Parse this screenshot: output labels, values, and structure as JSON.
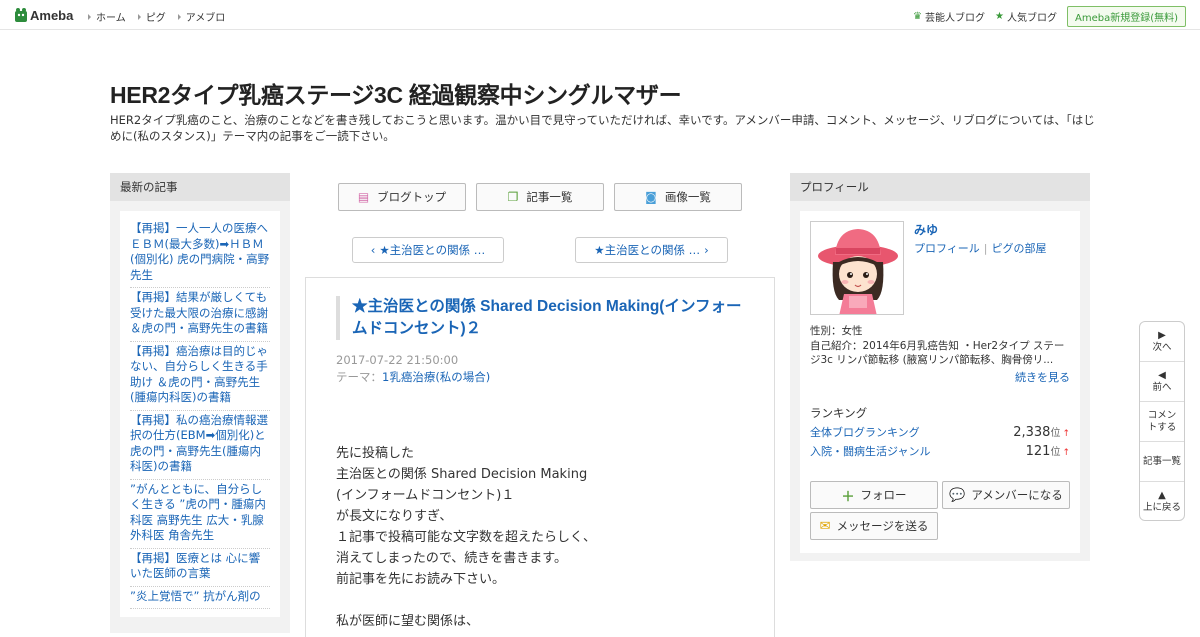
{
  "header": {
    "logo_text": "Ameba",
    "nav": [
      "ホーム",
      "ピグ",
      "アメブロ"
    ],
    "right_links": [
      {
        "label": "芸能人ブログ",
        "icon": "crown-icon"
      },
      {
        "label": "人気ブログ",
        "icon": "star-icon"
      }
    ],
    "register_label": "Ameba新規登録(無料)"
  },
  "blog": {
    "title": "HER2タイプ乳癌ステージ3C 経過観察中シングルマザー",
    "description": "HER2タイプ乳癌のこと、治療のことなどを書き残しておこうと思います。温かい目で見守っていただければ、幸いです。アメンバー申請、コメント、メッセージ、リブログについては、「はじめに(私のスタンス)」テーマ内の記事をご一読下さい。"
  },
  "recent": {
    "heading": "最新の記事",
    "items": [
      "【再掲】一人一人の医療へ ＥＢＭ(最大多数)➡ＨＢＭ(個別化) 虎の門病院・高野先生",
      "【再掲】結果が厳しくても受けた最大限の治療に感謝 ＆虎の門・高野先生の書籍",
      "【再掲】癌治療は目的じゃない、自分らしく生きる手助け ＆虎の門・高野先生(腫瘍内科医)の書籍",
      "【再掲】私の癌治療情報選択の仕方(EBM➡個別化)と虎の門・高野先生(腫瘍内科医)の書籍",
      "”がんとともに、自分らしく生きる ”虎の門・腫瘍内科医 高野先生 広大・乳腺外科医 角舎先生",
      "【再掲】医療とは 心に響いた医師の言葉",
      "”炎上覚悟で” 抗がん剤の"
    ]
  },
  "tabs": [
    {
      "label": "ブログトップ",
      "icon": "document-icon"
    },
    {
      "label": "記事一覧",
      "icon": "list-icon"
    },
    {
      "label": "画像一覧",
      "icon": "camera-icon"
    }
  ],
  "pager": {
    "prev": "★主治医との関係 …",
    "next": "★主治医との関係 …"
  },
  "entry": {
    "title": "★主治医との関係 Shared Decision Making(インフォームドコンセント)２",
    "date": "2017-07-22 21:50:00",
    "theme_label": "テーマ：",
    "theme": "1乳癌治療(私の場合)",
    "body": [
      "先に投稿した",
      "主治医との関係  Shared Decision Making",
      "(インフォームドコンセント)１",
      "が長文になりすぎ、",
      "１記事で投稿可能な文字数を超えたらしく、",
      "消えてしまったので、続きを書きます。",
      "前記事を先にお読み下さい。",
      "",
      "私が医師に望む関係は、"
    ]
  },
  "profile": {
    "heading": "プロフィール",
    "name": "みゆ",
    "link_profile": "プロフィール",
    "link_room": "ピグの部屋",
    "gender": "性別：女性",
    "intro": "自己紹介：2014年6月乳癌告知 ・Her2タイプ ステージ3c リンパ節転移 (腋窩リンパ節転移、胸骨傍リ...",
    "more": "続きを見る",
    "ranking_heading": "ランキング",
    "rankings": [
      {
        "label": "全体ブログランキング",
        "value": "2,338",
        "unit": "位",
        "trend": "↑"
      },
      {
        "label": "入院・闘病生活ジャンル",
        "value": "121",
        "unit": "位",
        "trend": "↑"
      }
    ],
    "buttons": {
      "follow": "フォロー",
      "amember": "アメンバーになる",
      "message": "メッセージを送る"
    }
  },
  "floating_nav": [
    {
      "label": "次へ",
      "icon": "▶"
    },
    {
      "label": "前へ",
      "icon": "◀"
    },
    {
      "label": "コメントする",
      "icon": ""
    },
    {
      "label": "記事一覧",
      "icon": ""
    },
    {
      "label": "上に戻る",
      "icon": "▲"
    }
  ],
  "colors": {
    "link": "#1a65b6",
    "accent_green": "#3a9a3a",
    "panel_bg": "#f2f2f2"
  }
}
